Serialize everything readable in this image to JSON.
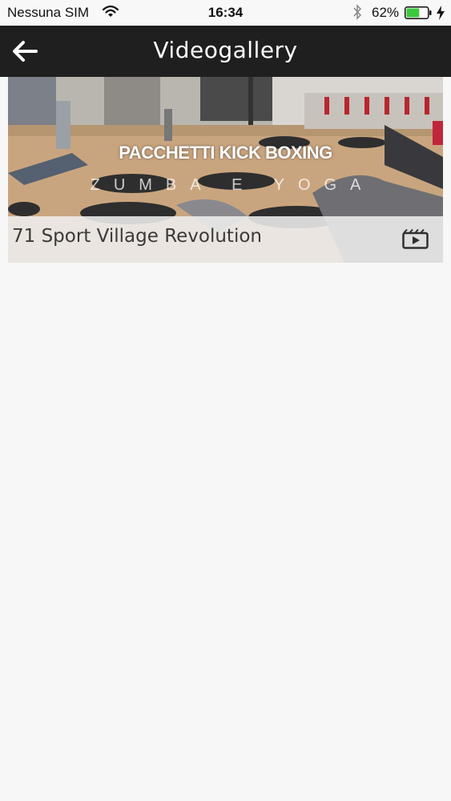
{
  "status_bar": {
    "carrier": "Nessuna SIM",
    "time": "16:34",
    "battery_percent": "62%",
    "battery_level": 0.62,
    "battery_color": "#3cc83c",
    "icons": [
      "wifi-icon",
      "bluetooth-icon",
      "battery-icon",
      "charging-bolt-icon"
    ]
  },
  "nav_bar": {
    "title": "Videogallery",
    "back_icon": "arrow-left-icon",
    "background": "#1f1f1f"
  },
  "videos": [
    {
      "title": "71 Sport Village Revolution",
      "thumbnail_text": "PACCHETTI KICK BOXING",
      "thumbnail_subtext": "ZUMBA E YOGA",
      "icon": "video-play-icon"
    }
  ]
}
